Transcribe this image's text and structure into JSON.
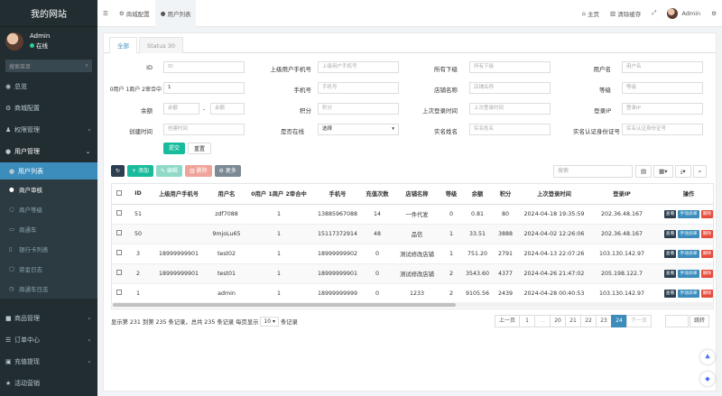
{
  "app": {
    "title": "我的网站"
  },
  "user": {
    "name": "Admin",
    "status": "在线"
  },
  "sidebar": {
    "search_placeholder": "搜索菜单",
    "items": [
      {
        "label": "总览",
        "icon": "dashboard-icon"
      },
      {
        "label": "商城配置",
        "icon": "gear-icon"
      },
      {
        "label": "权限管理",
        "icon": "group-icon"
      },
      {
        "label": "用户管理",
        "icon": "user-icon"
      }
    ],
    "sub": [
      {
        "label": "用户列表"
      },
      {
        "label": "商户审核"
      },
      {
        "label": "商户等级"
      },
      {
        "label": "商通车"
      },
      {
        "label": "银行卡列表"
      },
      {
        "label": "资金日志"
      },
      {
        "label": "商通车日志"
      }
    ],
    "bottom": [
      {
        "label": "商品管理"
      },
      {
        "label": "订单中心"
      },
      {
        "label": "充值提现"
      },
      {
        "label": "活动营销"
      }
    ]
  },
  "topbar": {
    "tabs": [
      {
        "label": "商城配置"
      },
      {
        "label": "用户列表"
      }
    ],
    "home": "主页",
    "clear_cache": "清除缓存",
    "user": "Admin"
  },
  "tabs": [
    {
      "label": "全部"
    },
    {
      "label": "Status 30"
    }
  ],
  "filters": {
    "id": {
      "label": "ID",
      "placeholder": "ID"
    },
    "parent_phone": {
      "label": "上级用户手机号",
      "placeholder": "上级用户手机号"
    },
    "all_sub": {
      "label": "所有下级",
      "placeholder": "所有下级"
    },
    "username": {
      "label": "用户名",
      "placeholder": "用户名"
    },
    "type": {
      "label": "0用户 1商户 2审合中",
      "value": "1"
    },
    "phone": {
      "label": "手机号",
      "placeholder": "手机号"
    },
    "shop": {
      "label": "店铺名称",
      "placeholder": "店铺名称"
    },
    "level": {
      "label": "等级",
      "placeholder": "等级"
    },
    "balance": {
      "label": "余额",
      "placeholder": "余额",
      "dash": "-"
    },
    "points": {
      "label": "积分",
      "placeholder": "积分"
    },
    "last_login": {
      "label": "上次登录时间",
      "placeholder": "上次登录时间"
    },
    "login_ip": {
      "label": "登录IP",
      "placeholder": "登录IP"
    },
    "created": {
      "label": "创建时间",
      "placeholder": "创建时间"
    },
    "online": {
      "label": "是否在线",
      "value": "选择"
    },
    "realname": {
      "label": "实名姓名",
      "placeholder": "实名姓名"
    },
    "idcard": {
      "label": "实名认证身份证号",
      "placeholder": "实名认证身份证号"
    },
    "submit": "提交",
    "reset": "重置"
  },
  "toolbar": {
    "add": "添加",
    "edit": "编辑",
    "del": "删除",
    "more": "更多",
    "search_placeholder": "搜索"
  },
  "table": {
    "columns": [
      "ID",
      "上级用户手机号",
      "用户名",
      "0用户 1商户 2审合中",
      "手机号",
      "充值次数",
      "店铺名称",
      "等级",
      "余额",
      "积分",
      "上次登录时间",
      "登录IP",
      "操作"
    ],
    "rows": [
      {
        "id": "51",
        "parent": "",
        "name": "zdf7088",
        "type": "1",
        "phone": "13885967088",
        "recharge": "14",
        "shop": "一件代发",
        "level": "0",
        "balance": "0.81",
        "points": "80",
        "last": "2024-04-18 19:35:59",
        "ip": "202.36.48.167"
      },
      {
        "id": "50",
        "parent": "",
        "name": "9mjoLu65",
        "type": "1",
        "phone": "15117372914",
        "recharge": "48",
        "shop": "品信",
        "level": "1",
        "balance": "33.51",
        "points": "3888",
        "last": "2024-04-02 12:26:06",
        "ip": "202.36.48.167"
      },
      {
        "id": "3",
        "parent": "18999999901",
        "name": "test02",
        "type": "1",
        "phone": "18999999902",
        "recharge": "0",
        "shop": "测试修改店铺",
        "level": "1",
        "balance": "751.20",
        "points": "2791",
        "last": "2024-04-13 22:07:26",
        "ip": "103.130.142.97"
      },
      {
        "id": "2",
        "parent": "18999999901",
        "name": "test01",
        "type": "1",
        "phone": "18999999901",
        "recharge": "0",
        "shop": "测试修改店铺",
        "level": "2",
        "balance": "3543.60",
        "points": "4377",
        "last": "2024-04-26 21:47:02",
        "ip": "205.198.122.7"
      },
      {
        "id": "1",
        "parent": "",
        "name": "admin",
        "type": "1",
        "phone": "18999999999",
        "recharge": "0",
        "shop": "1233",
        "level": "2",
        "balance": "9105.56",
        "points": "2439",
        "last": "2024-04-28 00:40:53",
        "ip": "103.130.142.97"
      }
    ],
    "ops": {
      "view": "查看",
      "manual": "手动派单",
      "del": "删除"
    }
  },
  "footer": {
    "info": "显示第 231 到第 235 条记录，总共 235 条记录 每页显示",
    "pagesize": "10",
    "suffix": "条记录"
  },
  "pager": {
    "prev": "上一页",
    "pages": [
      "1",
      "...",
      "20",
      "21",
      "22",
      "23",
      "24"
    ],
    "current": "24",
    "next": "下一页",
    "jump": "跳转"
  },
  "colors": {
    "primary": "#3c8dbc",
    "success": "#18bc9c",
    "danger": "#e74c3c",
    "sidebar": "#222d32"
  }
}
